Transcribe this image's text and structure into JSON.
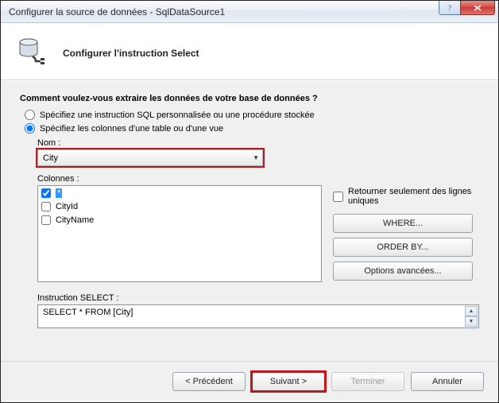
{
  "window": {
    "title": "Configurer la source de données - SqlDataSource1"
  },
  "header": {
    "title": "Configurer l'instruction Select"
  },
  "question": "Comment voulez-vous extraire les données de votre base de données ?",
  "radios": {
    "custom_sql": "Spécifiez une instruction SQL personnalisée ou une procédure stockée",
    "table_columns": "Spécifiez les colonnes d'une table ou d'une vue"
  },
  "name_label": "Nom :",
  "name_value": "City",
  "columns_label": "Colonnes :",
  "columns": [
    {
      "label": "*",
      "checked": true,
      "selected": true
    },
    {
      "label": "CityId",
      "checked": false,
      "selected": false
    },
    {
      "label": "CityName",
      "checked": false,
      "selected": false
    }
  ],
  "unique_rows_label": "Retourner seulement des lignes uniques",
  "buttons": {
    "where": "WHERE...",
    "orderby": "ORDER BY...",
    "advanced": "Options avancées..."
  },
  "select_label": "Instruction SELECT :",
  "select_stmt": "SELECT * FROM [City]",
  "nav": {
    "prev": "< Précédent",
    "next": "Suivant >",
    "finish": "Terminer",
    "cancel": "Annuler"
  }
}
